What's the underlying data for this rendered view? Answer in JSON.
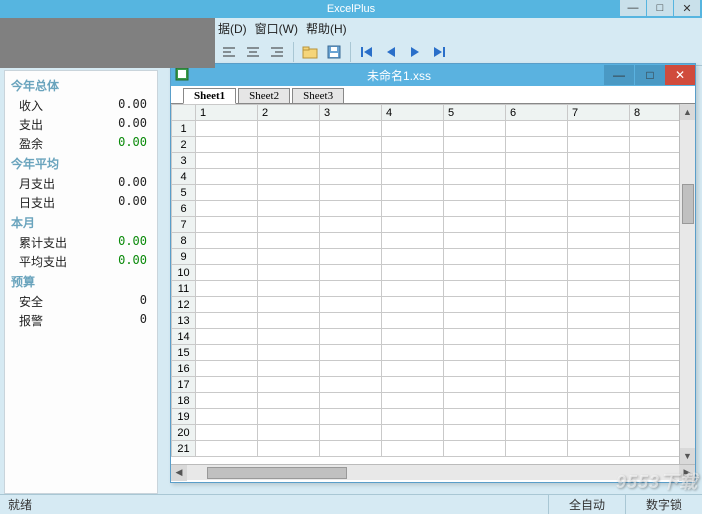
{
  "app": {
    "title": "ExcelPlus"
  },
  "window_controls": {
    "min": "—",
    "max": "□",
    "close": "✕"
  },
  "menu": {
    "data_label": "据(D)",
    "window_label": "窗口(W)",
    "help_label": "帮助(H)"
  },
  "toolbar": {
    "icons": {
      "align_left": "align-left-icon",
      "align_center": "align-center-icon",
      "align_right": "align-right-icon",
      "folder": "folder-icon",
      "save": "save-icon",
      "first": "first-icon",
      "prev": "prev-icon",
      "next": "next-icon",
      "last": "last-icon"
    }
  },
  "sidebar": {
    "s1": {
      "header": "今年总体",
      "r1": {
        "label": "收入",
        "value": "0.00"
      },
      "r2": {
        "label": "支出",
        "value": "0.00"
      },
      "r3": {
        "label": "盈余",
        "value": "0.00"
      }
    },
    "s2": {
      "header": "今年平均",
      "r1": {
        "label": "月支出",
        "value": "0.00"
      },
      "r2": {
        "label": "日支出",
        "value": "0.00"
      }
    },
    "s3": {
      "header": "本月",
      "r1": {
        "label": "累计支出",
        "value": "0.00"
      },
      "r2": {
        "label": "平均支出",
        "value": "0.00"
      }
    },
    "s4": {
      "header": "预算",
      "r1": {
        "label": "安全",
        "value": "0"
      },
      "r2": {
        "label": "报警",
        "value": "0"
      }
    }
  },
  "doc": {
    "title": "未命名1.xss",
    "tabs": [
      "Sheet1",
      "Sheet2",
      "Sheet3"
    ],
    "active_tab": 0,
    "columns": [
      "1",
      "2",
      "3",
      "4",
      "5",
      "6",
      "7",
      "8"
    ],
    "rows": [
      "1",
      "2",
      "3",
      "4",
      "5",
      "6",
      "7",
      "8",
      "9",
      "10",
      "11",
      "12",
      "13",
      "14",
      "15",
      "16",
      "17",
      "18",
      "19",
      "20",
      "21"
    ]
  },
  "status": {
    "left": "就绪",
    "auto": "全自动",
    "numlock": "数字锁"
  },
  "watermark": "9553下载"
}
